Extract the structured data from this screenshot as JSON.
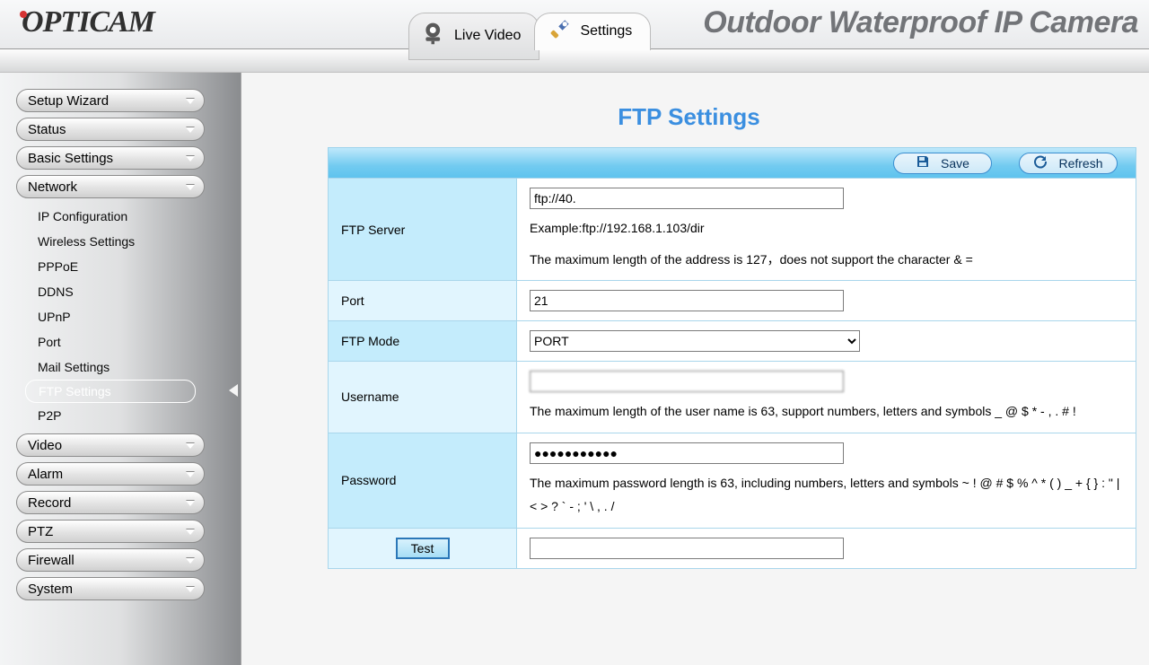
{
  "brand": "OPTICAM",
  "header_title": "Outdoor Waterproof IP Camera",
  "tabs": {
    "live": "Live Video",
    "settings": "Settings"
  },
  "sidebar": {
    "groups": [
      "Setup Wizard",
      "Status",
      "Basic Settings",
      "Network",
      "Video",
      "Alarm",
      "Record",
      "PTZ",
      "Firewall",
      "System"
    ],
    "network_items": [
      "IP Configuration",
      "Wireless Settings",
      "PPPoE",
      "DDNS",
      "UPnP",
      "Port",
      "Mail Settings",
      "FTP Settings",
      "P2P"
    ],
    "selected_sub": "FTP Settings"
  },
  "page": {
    "title": "FTP Settings",
    "buttons": {
      "save": "Save",
      "refresh": "Refresh",
      "test": "Test"
    },
    "rows": {
      "ftp_server": {
        "label": "FTP Server",
        "value": "ftp://40.",
        "example": "Example:ftp://192.168.1.103/dir",
        "help": "The maximum length of the address is 127，does not support the character & ="
      },
      "port": {
        "label": "Port",
        "value": "21"
      },
      "ftp_mode": {
        "label": "FTP Mode",
        "value": "PORT"
      },
      "username": {
        "label": "Username",
        "value": "",
        "help": "The maximum length of the user name is 63, support numbers, letters and symbols _ @ $ * - , . # !"
      },
      "password": {
        "label": "Password",
        "value": "●●●●●●●●●●●",
        "help": "The maximum password length is 63, including numbers, letters and symbols ~ ! @ # $ % ^ * ( ) _ + { } : \" | < > ? ` - ; ' \\ , . /"
      },
      "test_result": {
        "value": ""
      }
    }
  }
}
